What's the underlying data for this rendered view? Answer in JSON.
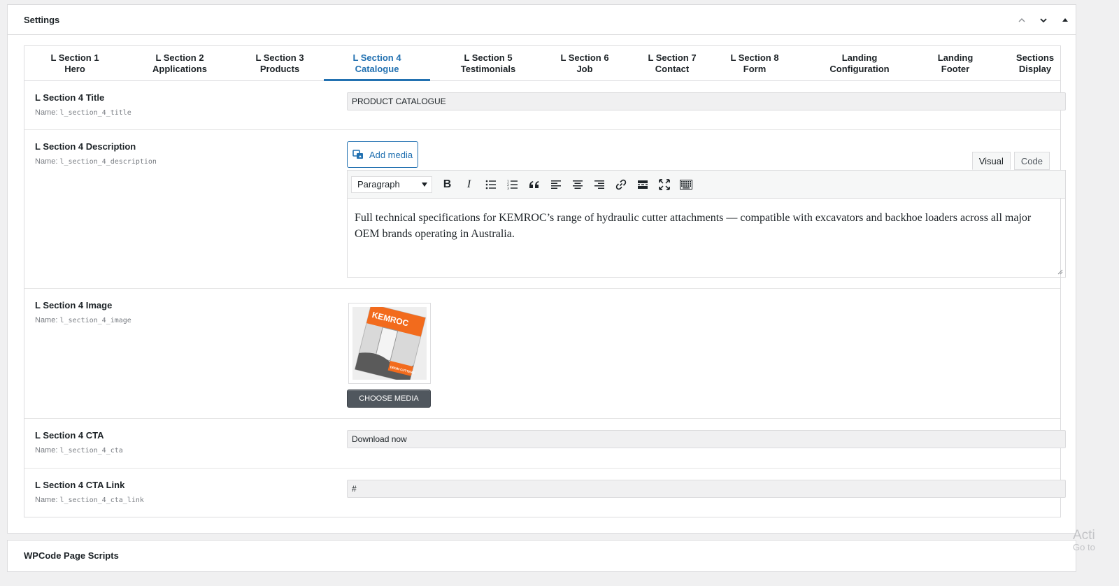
{
  "settings_box": {
    "title": "Settings",
    "actions": [
      {
        "name": "move-up-icon"
      },
      {
        "name": "move-down-icon"
      },
      {
        "name": "toggle-panel-icon"
      }
    ]
  },
  "tabs": [
    {
      "line1": "L Section 1",
      "line2": "Hero",
      "active": false
    },
    {
      "line1": "L Section 2",
      "line2": "Applications",
      "active": false
    },
    {
      "line1": "L Section 3",
      "line2": "Products",
      "active": false
    },
    {
      "line1": "L Section 4",
      "line2": "Catalogue",
      "active": true
    },
    {
      "line1": "L Section 5",
      "line2": "Testimonials",
      "active": false
    },
    {
      "line1": "L Section 6",
      "line2": "Job",
      "active": false
    },
    {
      "line1": "L Section 7",
      "line2": "Contact",
      "active": false
    },
    {
      "line1": "L Section 8",
      "line2": "Form",
      "active": false
    },
    {
      "line1": "Landing",
      "line2": "Configuration",
      "active": false
    },
    {
      "line1": "Landing",
      "line2": "Footer",
      "active": false
    },
    {
      "line1": "Sections",
      "line2": "Display",
      "active": false
    }
  ],
  "fields": {
    "title": {
      "label": "L Section 4 Title",
      "name_prefix": "Name: ",
      "name": "l_section_4_title",
      "value": "PRODUCT CATALOGUE"
    },
    "description": {
      "label": "L Section 4 Description",
      "name_prefix": "Name: ",
      "name": "l_section_4_description",
      "add_media": "Add media",
      "tab_visual": "Visual",
      "tab_code": "Code",
      "format": "Paragraph",
      "content": "Full technical specifications for KEMROC’s range of hydraulic cutter attachments — compatible with excavators and backhoe loaders across all major OEM brands operating in Australia."
    },
    "image": {
      "label": "L Section 4 Image",
      "name_prefix": "Name: ",
      "name": "l_section_4_image",
      "button": "CHOOSE MEDIA",
      "thumb_brand": "KEMROC",
      "thumb_caption": "DRUM CUTTERS"
    },
    "cta": {
      "label": "L Section 4 CTA",
      "name_prefix": "Name: ",
      "name": "l_section_4_cta",
      "value": "Download now"
    },
    "cta_link": {
      "label": "L Section 4 CTA Link",
      "name_prefix": "Name: ",
      "name": "l_section_4_cta_link",
      "value": "#"
    }
  },
  "wpcode_box": {
    "title": "WPCode Page Scripts"
  },
  "watermark": {
    "line1": "Acti",
    "line2": "Go to"
  },
  "colors": {
    "accent": "#2271b1",
    "border": "#dcdcde",
    "background": "#f0f0f1",
    "kemroc_orange": "#f26b1d"
  }
}
